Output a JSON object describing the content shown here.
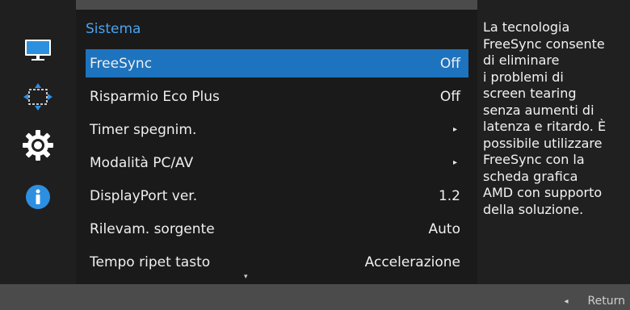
{
  "menu": {
    "title": "Sistema",
    "items": [
      {
        "label": "FreeSync",
        "value": "Off",
        "arrow": "",
        "selected": true
      },
      {
        "label": "Risparmio Eco Plus",
        "value": "Off",
        "arrow": "",
        "selected": false
      },
      {
        "label": "Timer spegnim.",
        "value": "",
        "arrow": "▸",
        "selected": false
      },
      {
        "label": "Modalità PC/AV",
        "value": "",
        "arrow": "▸",
        "selected": false
      },
      {
        "label": "DisplayPort ver.",
        "value": "1.2",
        "arrow": "",
        "selected": false
      },
      {
        "label": "Rilevam. sorgente",
        "value": "Auto",
        "arrow": "",
        "selected": false
      },
      {
        "label": "Tempo ripet tasto",
        "value": "Accelerazione",
        "arrow": "",
        "selected": false
      }
    ],
    "scroll_indicator": "▾"
  },
  "sidebar": {
    "icons": [
      "monitor-icon",
      "move-arrows-icon",
      "gear-icon",
      "info-icon"
    ],
    "active": "gear-icon"
  },
  "description": {
    "text": "La tecnologia\nFreeSync consente\ndi eliminare\ni problemi di\nscreen tearing\nsenza aumenti di\nlatenza e ritardo. È\npossibile utilizzare\nFreeSync con la\nscheda grafica\nAMD con supporto\ndella soluzione."
  },
  "footer": {
    "return_arrow": "◂",
    "return_label": "Return"
  },
  "colors": {
    "accent": "#1e73be",
    "title": "#4aa4f2",
    "icon_blue": "#2d8fe0"
  }
}
